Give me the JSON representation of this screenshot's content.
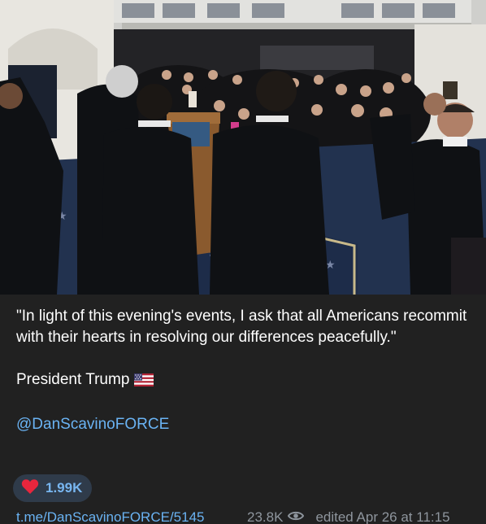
{
  "post": {
    "quote": "\"In light of this evening's events, I ask that all Americans recommit with their hearts in resolving our differences peacefully.\"",
    "signature": "President Trump",
    "flag_icon": "us-flag-icon",
    "mention": "@DanScavinoFORCE"
  },
  "reaction": {
    "icon": "heart-icon",
    "count": "1.99K"
  },
  "footer": {
    "link": "t.me/DanScavinoFORCE/5145",
    "views": "23.8K",
    "views_icon": "eye-icon",
    "edited": "edited Apr 26 at 11:15"
  }
}
